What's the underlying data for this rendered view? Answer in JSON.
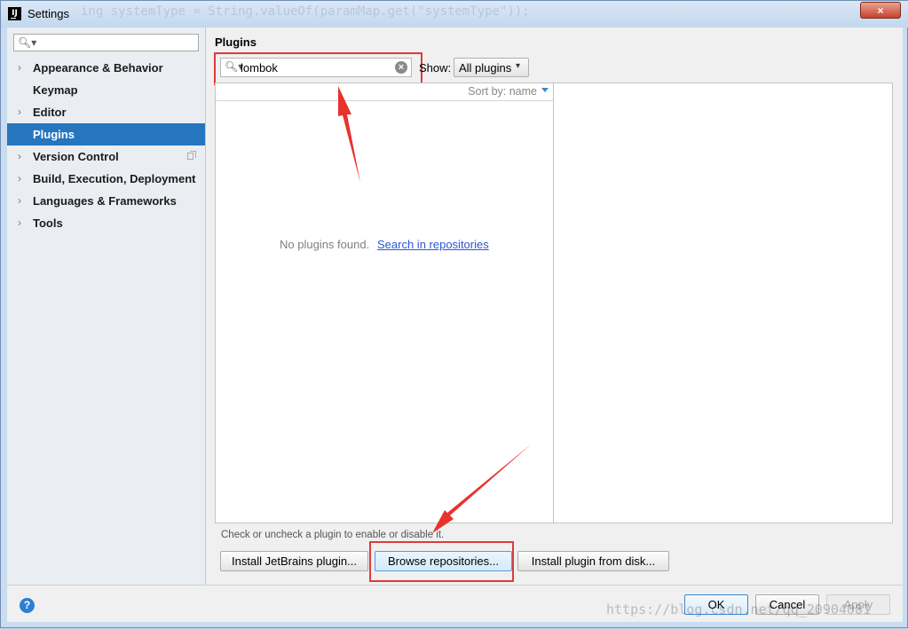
{
  "window": {
    "title": "Settings",
    "app_icon_text": "IJ",
    "close_label": "×"
  },
  "background_code": "ing systemType = String.valueOf(paramMap.get(\"systemType\"));",
  "sidebar": {
    "search_placeholder": "",
    "items": [
      {
        "label": "Appearance & Behavior",
        "expandable": true
      },
      {
        "label": "Keymap",
        "expandable": false
      },
      {
        "label": "Editor",
        "expandable": true
      },
      {
        "label": "Plugins",
        "expandable": false,
        "selected": true
      },
      {
        "label": "Version Control",
        "expandable": true,
        "has_project_icon": true
      },
      {
        "label": "Build, Execution, Deployment",
        "expandable": true
      },
      {
        "label": "Languages & Frameworks",
        "expandable": true
      },
      {
        "label": "Tools",
        "expandable": true
      }
    ]
  },
  "main": {
    "title": "Plugins",
    "search": {
      "value": "lombok"
    },
    "show": {
      "label": "Show:",
      "selected": "All plugins"
    },
    "sort": {
      "label": "Sort by: name"
    },
    "empty": {
      "text": "No plugins found.",
      "link": "Search in repositories"
    },
    "hint": "Check or uncheck a plugin to enable or disable it.",
    "buttons": {
      "install_jetbrains": "Install JetBrains plugin...",
      "browse": "Browse repositories...",
      "install_disk": "Install plugin from disk..."
    }
  },
  "footer": {
    "help_label": "?",
    "ok": "OK",
    "cancel": "Cancel",
    "apply": "Apply"
  },
  "watermark": "https://blog.csdn.net/qq_20904081",
  "colors": {
    "selection": "#2675bf",
    "highlight": "#e23a3a",
    "link": "#2d56d8"
  }
}
